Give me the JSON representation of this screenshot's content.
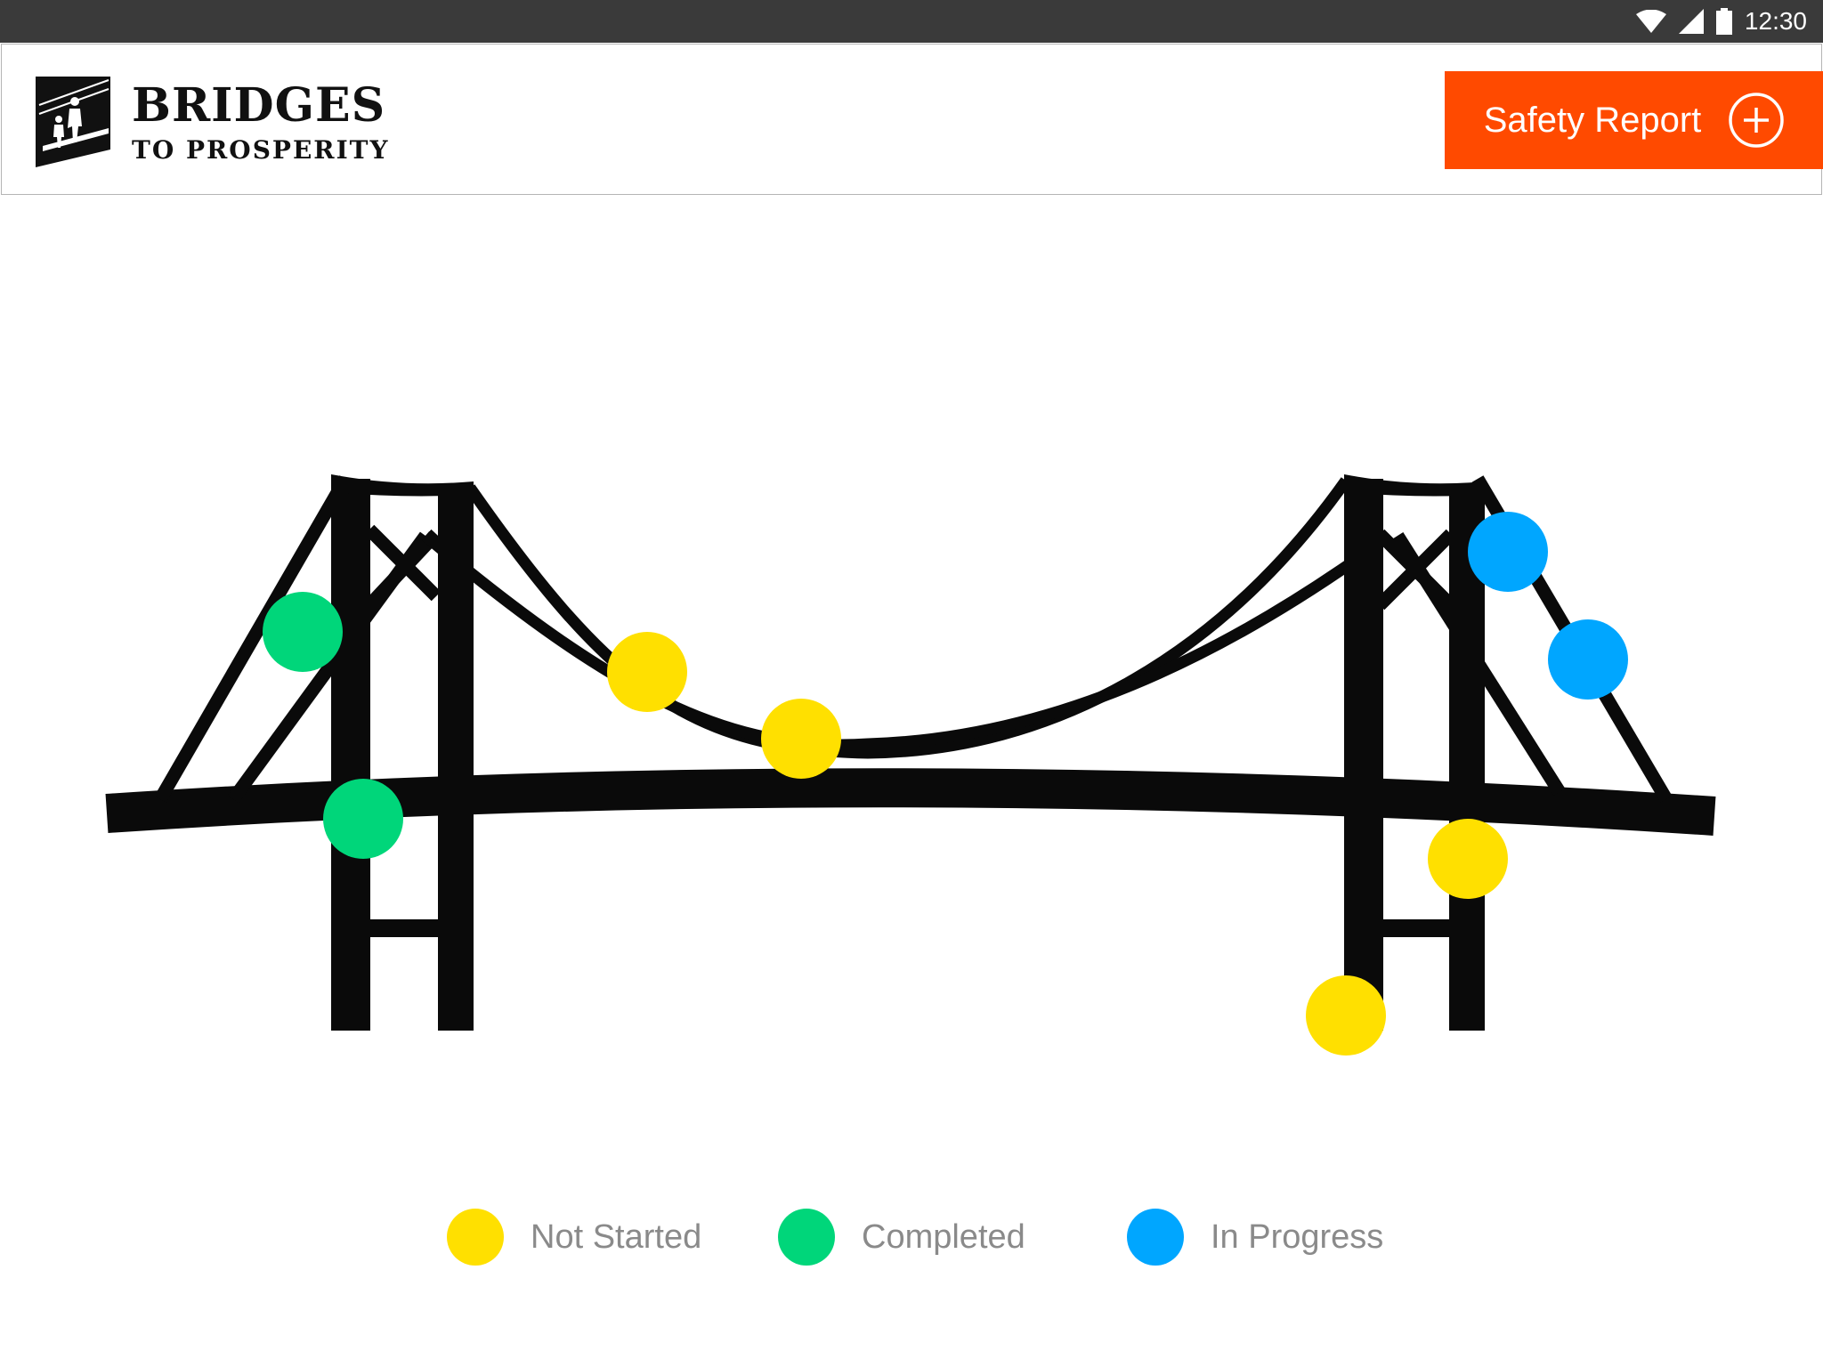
{
  "statusbar": {
    "time": "12:30",
    "icons": [
      "wifi-icon",
      "cell-signal-icon",
      "battery-icon"
    ]
  },
  "header": {
    "logo": {
      "title": "BRIDGES",
      "subtitle": "TO PROSPERITY"
    },
    "safety_button": {
      "label": "Safety Report",
      "icon": "plus-circle-icon",
      "color": "#ff4a00"
    }
  },
  "status_colors": {
    "not_started": "#ffe000",
    "completed": "#00d67a",
    "in_progress": "#00a6ff"
  },
  "inspection_points": [
    {
      "id": "left-anchor-cable",
      "status": "completed"
    },
    {
      "id": "left-tower-deck",
      "status": "completed"
    },
    {
      "id": "main-cable-left",
      "status": "not_started"
    },
    {
      "id": "main-cable-center",
      "status": "not_started"
    },
    {
      "id": "right-anchor-cable-upper",
      "status": "in_progress"
    },
    {
      "id": "right-anchor-cable-lower",
      "status": "in_progress"
    },
    {
      "id": "right-tower-deck",
      "status": "not_started"
    },
    {
      "id": "right-tower-base",
      "status": "not_started"
    }
  ],
  "legend": [
    {
      "label": "Not Started",
      "status": "not_started"
    },
    {
      "label": "Completed",
      "status": "completed"
    },
    {
      "label": "In Progress",
      "status": "in_progress"
    }
  ]
}
